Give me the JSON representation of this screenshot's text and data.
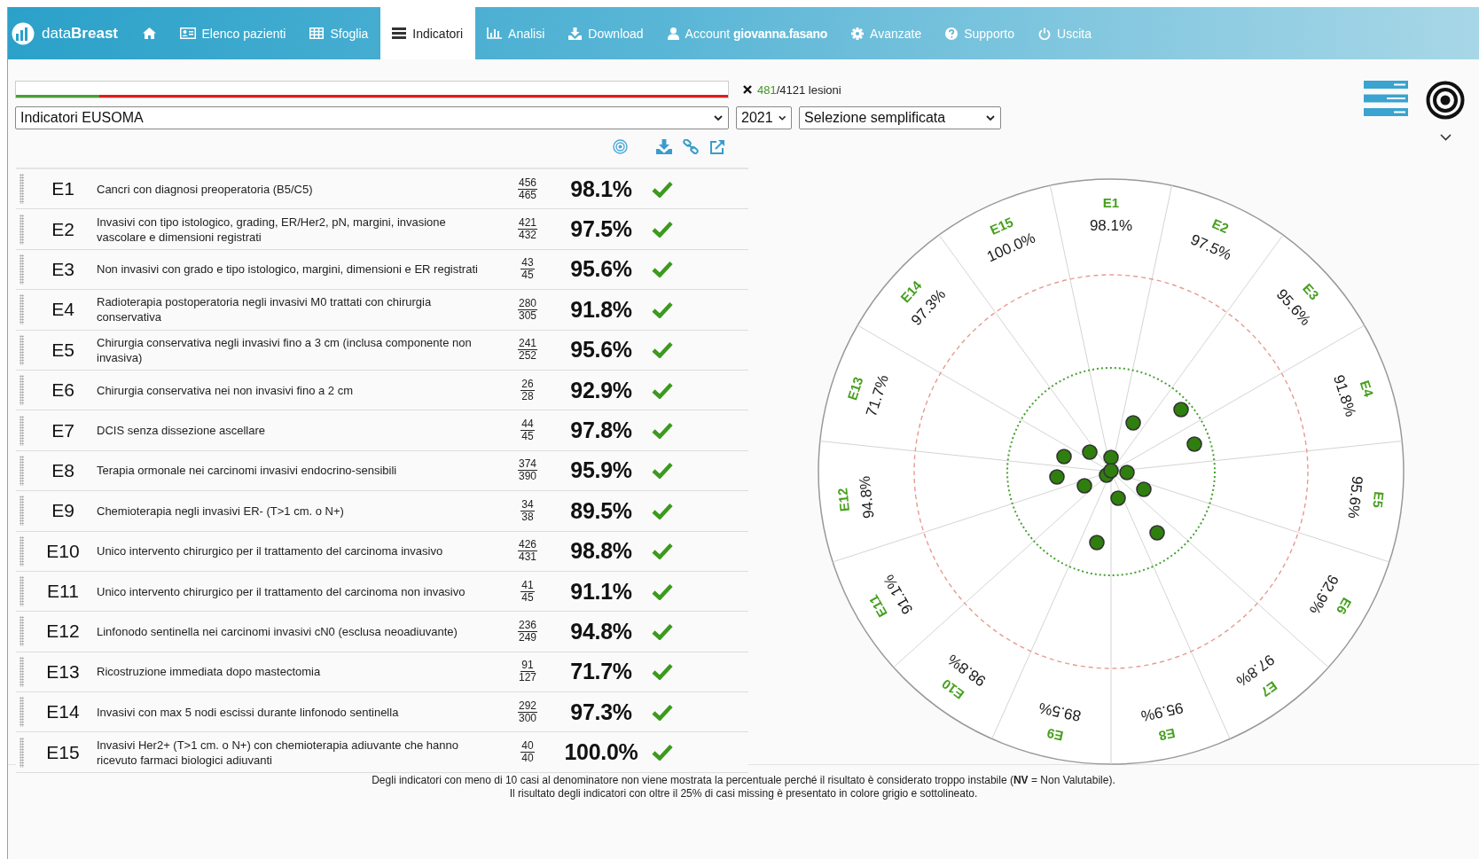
{
  "nav": {
    "logo": {
      "light": "data",
      "bold": "Breast"
    },
    "items": [
      {
        "selected": false
      },
      {
        "label": "Elenco pazienti",
        "selected": false
      },
      {
        "label": "Sfoglia",
        "selected": false
      },
      {
        "label": "Indicatori",
        "selected": true
      },
      {
        "label": "Analisi",
        "selected": false
      },
      {
        "label": "Download",
        "selected": false
      },
      {
        "label": "Account **giovanna.fasano**",
        "selected": false
      },
      {
        "label": "Avanzate",
        "selected": false
      },
      {
        "label": "Supporto",
        "selected": false
      },
      {
        "label": "Uscita",
        "selected": false
      }
    ]
  },
  "progress": {
    "level": 0.117
  },
  "lesions": {
    "selected": "481",
    "total": "/4121 lesioni"
  },
  "filters": {
    "indicator_set": "Indicatori EUSOMA",
    "year": "2021",
    "selection_mode": "Selezione semplificata"
  },
  "indicators": [
    {
      "code": "E1",
      "description": "Cancri con diagnosi preoperatoria (B5/C5)",
      "numerator": "456",
      "denominator": "465",
      "percent": "98.1%",
      "met": true
    },
    {
      "code": "E2",
      "description": "Invasivi con tipo istologico, grading, ER/Her2, pN, margini, invasione vascolare e dimensioni registrati",
      "numerator": "421",
      "denominator": "432",
      "percent": "97.5%",
      "met": true
    },
    {
      "code": "E3",
      "description": "Non invasivi con grado e tipo istologico, margini, dimensioni e ER registrati",
      "numerator": "43",
      "denominator": "45",
      "percent": "95.6%",
      "met": true
    },
    {
      "code": "E4",
      "description": "Radioterapia postoperatoria negli invasivi M0 trattati con chirurgia conservativa",
      "numerator": "280",
      "denominator": "305",
      "percent": "91.8%",
      "met": true
    },
    {
      "code": "E5",
      "description": "Chirurgia conservativa negli invasivi fino a 3 cm (inclusa componente non invasiva)",
      "numerator": "241",
      "denominator": "252",
      "percent": "95.6%",
      "met": true
    },
    {
      "code": "E6",
      "description": "Chirurgia conservativa nei non invasivi fino a 2 cm",
      "numerator": "26",
      "denominator": "28",
      "percent": "92.9%",
      "met": true
    },
    {
      "code": "E7",
      "description": "DCIS senza dissezione ascellare",
      "numerator": "44",
      "denominator": "45",
      "percent": "97.8%",
      "met": true
    },
    {
      "code": "E8",
      "description": "Terapia ormonale nei carcinomi invasivi endocrino-sensibili",
      "numerator": "374",
      "denominator": "390",
      "percent": "95.9%",
      "met": true
    },
    {
      "code": "E9",
      "description": "Chemioterapia negli invasivi ER- (T>1 cm. o N+)",
      "numerator": "34",
      "denominator": "38",
      "percent": "89.5%",
      "met": true
    },
    {
      "code": "E10",
      "description": "Unico intervento chirurgico per il trattamento del carcinoma invasivo",
      "numerator": "426",
      "denominator": "431",
      "percent": "98.8%",
      "met": true
    },
    {
      "code": "E11",
      "description": "Unico intervento chirurgico per il trattamento del carcinoma non invasivo",
      "numerator": "41",
      "denominator": "45",
      "percent": "91.1%",
      "met": true
    },
    {
      "code": "E12",
      "description": "Linfonodo sentinella nei carcinomi invasivi cN0 (esclusa neoadiuvante)",
      "numerator": "236",
      "denominator": "249",
      "percent": "94.8%",
      "met": true
    },
    {
      "code": "E13",
      "description": "Ricostruzione immediata dopo mastectomia",
      "numerator": "91",
      "denominator": "127",
      "percent": "71.7%",
      "met": true
    },
    {
      "code": "E14",
      "description": "Invasivi con max 5 nodi escissi durante linfonodo sentinella",
      "numerator": "292",
      "denominator": "300",
      "percent": "97.3%",
      "met": true
    },
    {
      "code": "E15",
      "description": "Invasivi Her2+ (T>1 cm. o N+) con chemioterapia adiuvante che hanno ricevuto farmaci biologici adiuvanti",
      "numerator": "40",
      "denominator": "40",
      "percent": "100.0%",
      "met": true
    }
  ],
  "radar": {
    "sectors": [
      {
        "code": "E1",
        "value": "98.1%",
        "met": true
      },
      {
        "code": "E2",
        "value": "97.5%",
        "met": true
      },
      {
        "code": "E3",
        "value": "95.6%",
        "met": true
      },
      {
        "code": "E4",
        "value": "91.8%",
        "met": true
      },
      {
        "code": "E5",
        "value": "95.6%",
        "met": true
      },
      {
        "code": "E6",
        "value": "92.9%",
        "met": true
      },
      {
        "code": "E7",
        "value": "97.8%",
        "met": true
      },
      {
        "code": "E8",
        "value": "95.9%",
        "met": true
      },
      {
        "code": "E9",
        "value": "89.5%",
        "met": true
      },
      {
        "code": "E10",
        "value": "98.8%",
        "met": true
      },
      {
        "code": "E11",
        "value": "91.1%",
        "met": true
      },
      {
        "code": "E12",
        "value": "94.8%",
        "met": true
      },
      {
        "code": "E13",
        "value": "71.7%",
        "met": true
      },
      {
        "code": "E14",
        "value": "97.3%",
        "met": true
      },
      {
        "code": "E15",
        "value": "100.0%",
        "met": true
      }
    ]
  },
  "footnote": [
    "Degli indicatori con meno di 10 casi al denominatore non viene mostrata la percentuale perché il risultato è considerato troppo instabile (**NV** = Non Valutabile).",
    "Il risultato degli indicatori con oltre il 25% di casi missing è presentato in colore grigio e sottolineato."
  ]
}
